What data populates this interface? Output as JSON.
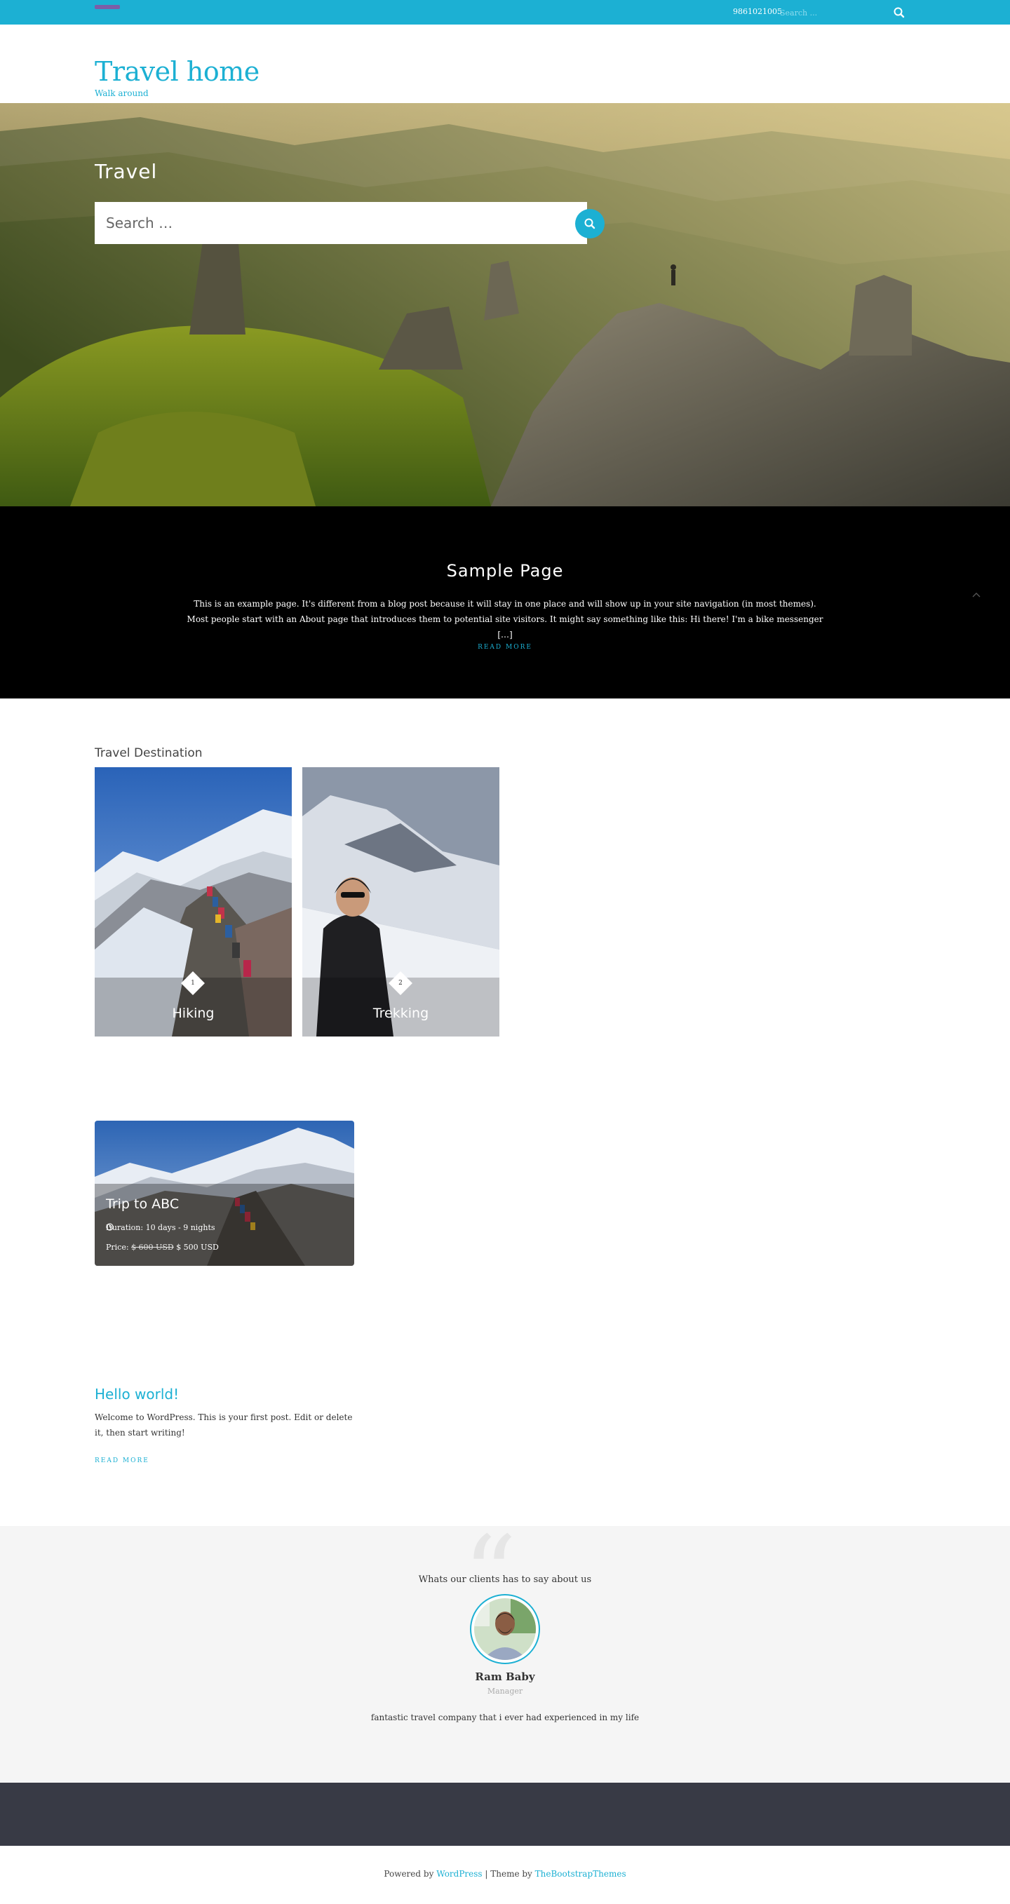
{
  "topbar": {
    "phone": "9861021005",
    "search_placeholder": "Search ..."
  },
  "header": {
    "site_title": "Travel home",
    "tagline": "Walk around"
  },
  "hero": {
    "title": "Travel",
    "search_placeholder": "Search …"
  },
  "featured_page": {
    "title": "Sample Page",
    "excerpt": "This is an example page. It's different from a blog post because it will stay in one place and will show up in your site navigation (in most themes). Most people start with an About page that introduces them to potential site visitors. It might say something like this: Hi there! I'm a bike messenger […]",
    "read_more": "READ MORE"
  },
  "destinations": {
    "heading": "Travel Destination",
    "items": [
      {
        "number": "1",
        "label": "Hiking"
      },
      {
        "number": "2",
        "label": "Trekking"
      }
    ]
  },
  "trip": {
    "title": "Trip to ABC",
    "duration": "Duration: 10 days - 9 nights",
    "price_label": "Price:",
    "price_old": "$ 600 USD",
    "price_new": "$ 500 USD"
  },
  "post": {
    "title": "Hello world!",
    "excerpt": "Welcome to WordPress. This is your first post. Edit or delete it, then start writing!",
    "read_more": "READ MORE"
  },
  "testimonials": {
    "heading": "Whats our clients has to say about us",
    "name": "Ram Baby",
    "role": "Manager",
    "quote": "fantastic travel company that i ever had experienced in my life"
  },
  "footer": {
    "powered_by": "Powered by",
    "wordpress": "WordPress",
    "separator": " | Theme by ",
    "theme_author": "TheBootstrapThemes"
  },
  "colors": {
    "accent": "#1cb0d3",
    "footer_dark": "#383a45",
    "testimonial_bg": "#f5f5f5"
  }
}
